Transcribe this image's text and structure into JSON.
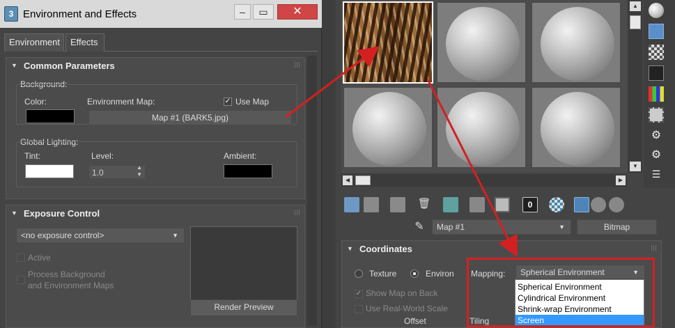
{
  "dialog": {
    "title": "Environment and Effects",
    "icon_text": "3",
    "controls": {
      "minimize": "–",
      "maximize": "▭",
      "close": "✕"
    },
    "tabs": [
      {
        "label": "Environment"
      },
      {
        "label": "Effects"
      }
    ],
    "common": {
      "header": "Common Parameters",
      "background_label": "Background:",
      "color_label": "Color:",
      "env_map_label": "Environment Map:",
      "use_map_label": "Use Map",
      "use_map_checked": true,
      "map_button": "Map #1 (BARK5.jpg)",
      "global_lighting_label": "Global Lighting:",
      "tint_label": "Tint:",
      "level_label": "Level:",
      "level_value": "1.0",
      "ambient_label": "Ambient:",
      "colors": {
        "background": "#000000",
        "tint": "#ffffff",
        "ambient": "#000000"
      }
    },
    "exposure": {
      "header": "Exposure Control",
      "dropdown_value": "<no exposure control>",
      "active_label": "Active",
      "process_label_line1": "Process Background",
      "process_label_line2": "and Environment Maps",
      "render_preview": "Render Preview"
    }
  },
  "material_editor": {
    "map_name": "Map #1",
    "map_type_button": "Bitmap",
    "sample_slots": [
      {
        "type": "bark-texture"
      },
      {
        "type": "sphere"
      },
      {
        "type": "sphere"
      },
      {
        "type": "sphere"
      },
      {
        "type": "sphere"
      },
      {
        "type": "sphere"
      }
    ],
    "toolbar_icons": [
      "get-material-icon",
      "put-to-scene-icon",
      "assign-material-icon",
      "delete-icon",
      "make-unique-icon",
      "put-to-library-icon",
      "save-icon",
      "material-id-icon",
      "show-map-icon",
      "show-end-result-icon",
      "go-to-parent-icon",
      "go-forward-sibling-icon"
    ],
    "material_id_value": "0",
    "side_tools": [
      "sample-type-icon",
      "backlight-icon",
      "background-icon",
      "uv-tiling-icon",
      "video-color-check-icon",
      "make-preview-icon",
      "options-icon",
      "select-by-material-icon",
      "material-navigator-icon"
    ],
    "coordinates": {
      "header": "Coordinates",
      "texture_label": "Texture",
      "environ_label": "Environ",
      "environ_selected": true,
      "mapping_label": "Mapping:",
      "mapping_value": "Spherical Environment",
      "mapping_options": [
        "Spherical Environment",
        "Cylindrical Environment",
        "Shrink-wrap Environment",
        "Screen"
      ],
      "highlighted_option": "Screen",
      "show_map_on_back": "Show Map on Back",
      "use_real_world_scale": "Use Real-World Scale",
      "offset_label": "Offset",
      "tiling_label": "Tiling"
    }
  },
  "annotation_color": "#d42020"
}
